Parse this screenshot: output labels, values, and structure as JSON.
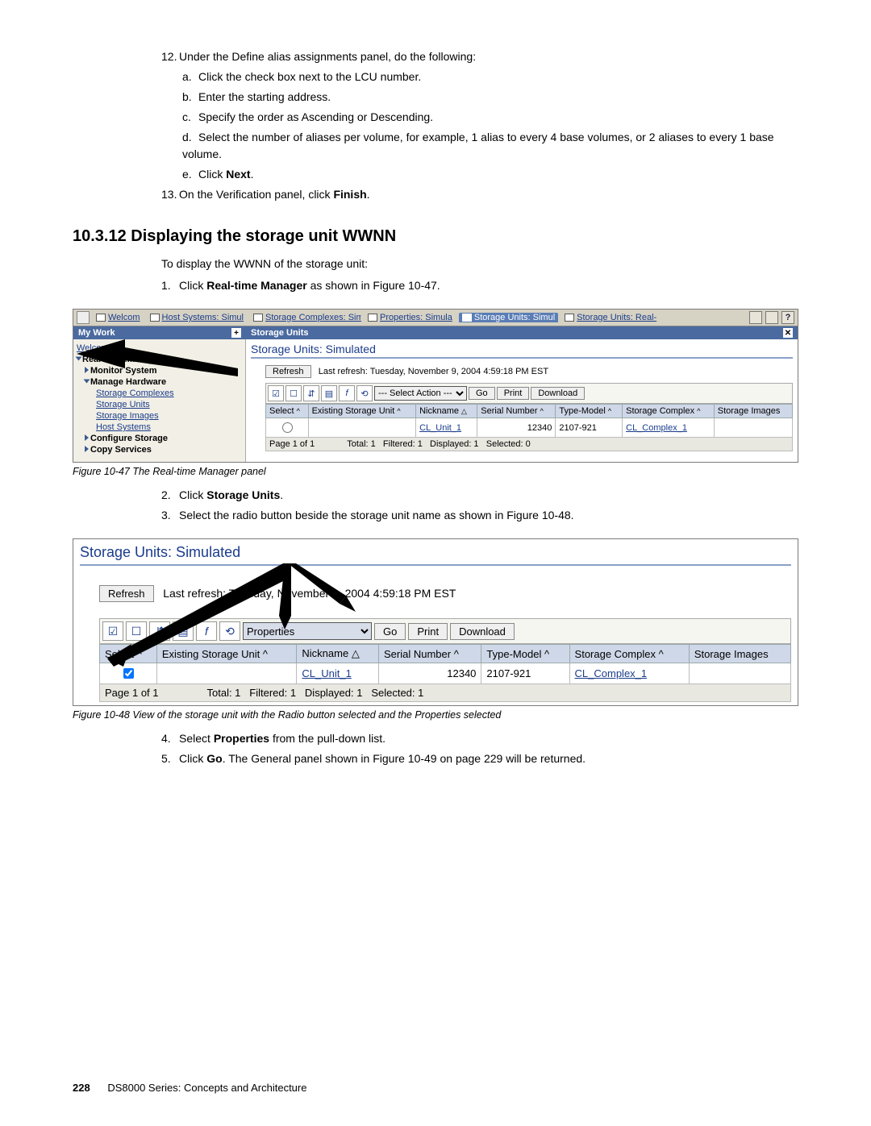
{
  "steps_top": {
    "s12": "Under the Define alias assignments panel, do the following:",
    "s12a": "Click the check box next to the LCU number.",
    "s12b": "Enter the starting address.",
    "s12c": "Specify the order as Ascending or Descending.",
    "s12d": "Select the number of aliases per volume, for example, 1 alias to every 4 base volumes, or 2 aliases to every 1 base volume.",
    "s12e_pre": "Click ",
    "s12e_bold": "Next",
    "s12e_post": ".",
    "s13_pre": "On the Verification panel, click ",
    "s13_bold": "Finish",
    "s13_post": "."
  },
  "heading": "10.3.12  Displaying the storage unit WWNN",
  "intro": "To display the WWNN of the storage unit:",
  "step1_pre": "Click ",
  "step1_bold": "Real-time Manager",
  "step1_post": " as shown in Figure 10-47.",
  "fig47": {
    "tabs": [
      "Welcom",
      "Host Systems: Simul",
      "Storage Complexes: Simu",
      "Properties: Simula",
      "Storage Units: Simul",
      "Storage Units: Real-"
    ],
    "mywork": "My Work",
    "storageunits_hdr": "Storage Units",
    "nav_welcome": "Welcome",
    "nav_rtm": "Real-time Manager",
    "nav_monitor": "Monitor System",
    "nav_managehw": "Manage Hardware",
    "nav_sc": "Storage Complexes",
    "nav_su": "Storage Units",
    "nav_si": "Storage Images",
    "nav_hs": "Host Systems",
    "nav_cfg": "Configure Storage",
    "nav_copy": "Copy Services",
    "main_title": "Storage Units: Simulated",
    "refresh": "Refresh",
    "last_refresh": "Last refresh: Tuesday, November 9, 2004 4:59:18 PM EST",
    "select_action": "--- Select Action ---",
    "go": "Go",
    "print": "Print",
    "download": "Download",
    "col_select": "Select",
    "col_esu": "Existing Storage Unit",
    "col_nick": "Nickname",
    "col_sn": "Serial Number",
    "col_tm": "Type-Model",
    "col_sc": "Storage Complex",
    "col_si": "Storage Images",
    "row_nick": "CL_Unit_1",
    "row_sn": "12340",
    "row_tm": "2107-921",
    "row_sc": "CL_Complex_1",
    "pager_page": "Page 1 of 1",
    "pager_total": "Total: 1",
    "pager_filtered": "Filtered: 1",
    "pager_displayed": "Displayed: 1",
    "pager_selected": "Selected: 0",
    "caption": "Figure 10-47   The Real-time Manager panel"
  },
  "step2_pre": "Click ",
  "step2_bold": "Storage Units",
  "step2_post": ".",
  "step3": "Select the radio button beside the storage unit name as shown in Figure 10-48.",
  "fig48": {
    "main_title": "Storage Units: Simulated",
    "refresh": "Refresh",
    "last_refresh": "Last refresh: Tuesday, November 9, 2004 4:59:18 PM EST",
    "action_value": "Properties",
    "go": "Go",
    "print": "Print",
    "download": "Download",
    "col_select": "Select",
    "col_esu": "Existing Storage Unit",
    "col_nick": "Nickname",
    "col_sn": "Serial Number",
    "col_tm": "Type-Model",
    "col_sc": "Storage Complex",
    "col_si": "Storage Images",
    "row_nick": "CL_Unit_1",
    "row_sn": "12340",
    "row_tm": "2107-921",
    "row_sc": "CL_Complex_1",
    "pager_page": "Page 1 of 1",
    "pager_total": "Total: 1",
    "pager_filtered": "Filtered: 1",
    "pager_displayed": "Displayed: 1",
    "pager_selected": "Selected: 1",
    "caption": "Figure 10-48   View of the storage unit with the Radio button selected and the Properties selected"
  },
  "step4_pre": "Select ",
  "step4_bold": "Properties",
  "step4_post": " from the pull-down list.",
  "step5_pre": "Click ",
  "step5_bold": "Go",
  "step5_post": ". The General panel shown in Figure 10-49 on page 229 will be returned.",
  "footer_page": "228",
  "footer_title": "DS8000 Series: Concepts and Architecture"
}
